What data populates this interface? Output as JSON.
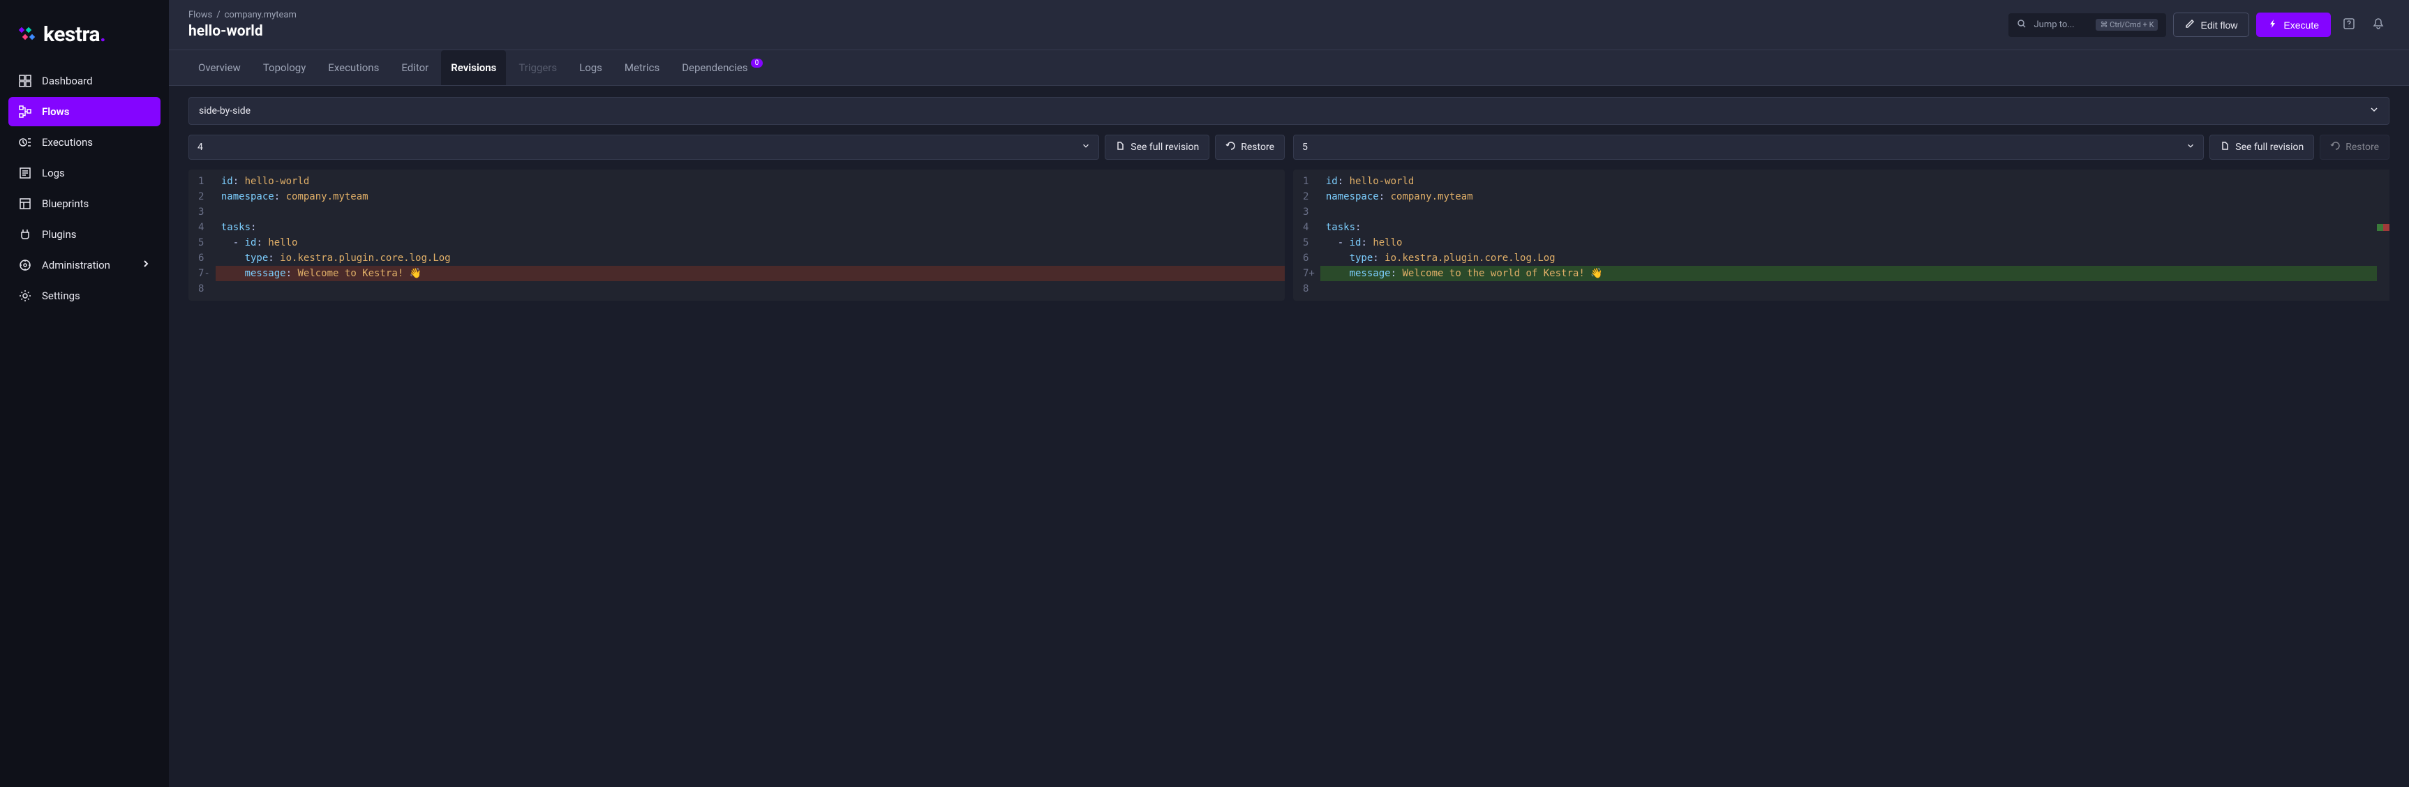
{
  "logo_text": "kestra",
  "breadcrumb": {
    "root": "Flows",
    "namespace": "company.myteam"
  },
  "page_title": "hello-world",
  "jump": {
    "placeholder": "Jump to...",
    "shortcut": "Ctrl/Cmd + K"
  },
  "header_actions": {
    "edit": "Edit flow",
    "execute": "Execute"
  },
  "sidebar": {
    "items": [
      {
        "label": "Dashboard"
      },
      {
        "label": "Flows"
      },
      {
        "label": "Executions"
      },
      {
        "label": "Logs"
      },
      {
        "label": "Blueprints"
      },
      {
        "label": "Plugins"
      },
      {
        "label": "Administration"
      },
      {
        "label": "Settings"
      }
    ]
  },
  "tabs": [
    {
      "label": "Overview"
    },
    {
      "label": "Topology"
    },
    {
      "label": "Executions"
    },
    {
      "label": "Editor"
    },
    {
      "label": "Revisions"
    },
    {
      "label": "Triggers"
    },
    {
      "label": "Logs"
    },
    {
      "label": "Metrics"
    },
    {
      "label": "Dependencies",
      "badge": "0"
    }
  ],
  "view_mode": "side-by-side",
  "left": {
    "revision": "4",
    "see_full": "See full revision",
    "restore": "Restore",
    "lines": [
      {
        "n": "1",
        "key": "id",
        "val": "hello-world"
      },
      {
        "n": "2",
        "key": "namespace",
        "val": "company.myteam"
      },
      {
        "n": "3"
      },
      {
        "n": "4",
        "key": "tasks"
      },
      {
        "n": "5",
        "dash": true,
        "key": "id",
        "val": "hello",
        "indent": "  "
      },
      {
        "n": "6",
        "key": "type",
        "val": "io.kestra.plugin.core.log.Log",
        "indent": "    "
      },
      {
        "n": "7",
        "mark": "-",
        "key": "message",
        "val": "Welcome to Kestra! 👋",
        "indent": "    ",
        "diff": "removed"
      },
      {
        "n": "8"
      }
    ]
  },
  "right": {
    "revision": "5",
    "see_full": "See full revision",
    "restore": "Restore",
    "lines": [
      {
        "n": "1",
        "key": "id",
        "val": "hello-world"
      },
      {
        "n": "2",
        "key": "namespace",
        "val": "company.myteam"
      },
      {
        "n": "3"
      },
      {
        "n": "4",
        "key": "tasks"
      },
      {
        "n": "5",
        "dash": true,
        "key": "id",
        "val": "hello",
        "indent": "  "
      },
      {
        "n": "6",
        "key": "type",
        "val": "io.kestra.plugin.core.log.Log",
        "indent": "    "
      },
      {
        "n": "7",
        "mark": "+",
        "key": "message",
        "val": "Welcome to the world of Kestra! 👋",
        "indent": "    ",
        "diff": "added"
      },
      {
        "n": "8"
      }
    ]
  }
}
